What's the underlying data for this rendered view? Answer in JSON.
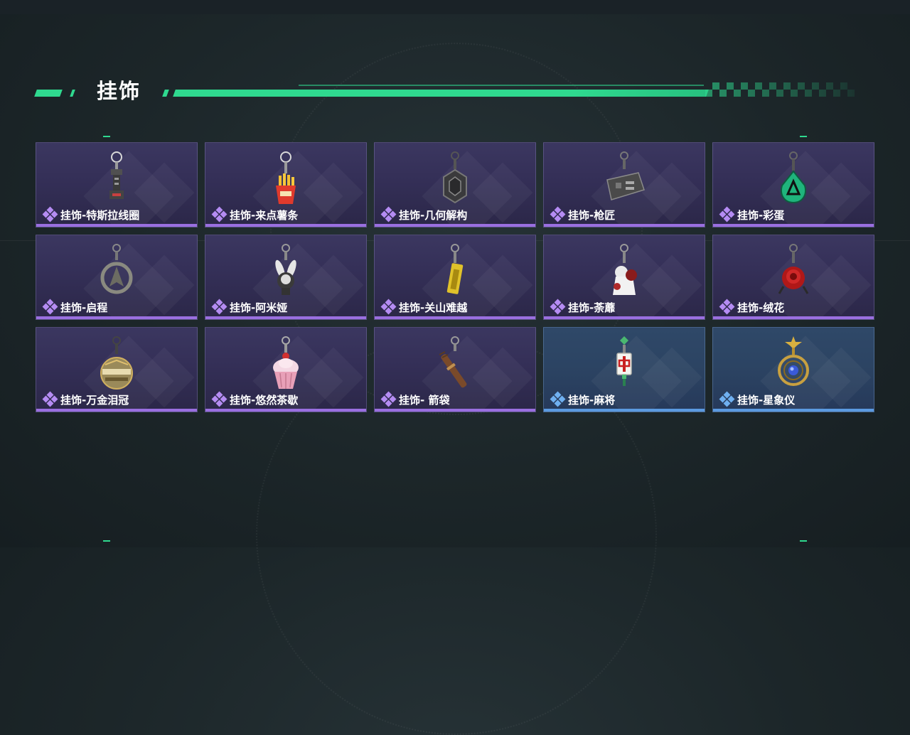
{
  "section": {
    "title": "挂饰"
  },
  "colors": {
    "accent": "#2fd98f",
    "rarity_purple": "#9a6fe0",
    "rarity_blue": "#5b9ae0"
  },
  "items": [
    {
      "name": "挂饰-特斯拉线圈",
      "rarity": "purple",
      "icon": "tesla-coil-charm-icon"
    },
    {
      "name": "挂饰-来点薯条",
      "rarity": "purple",
      "icon": "fries-charm-icon"
    },
    {
      "name": "挂饰-几何解构",
      "rarity": "purple",
      "icon": "geometric-charm-icon"
    },
    {
      "name": "挂饰-枪匠",
      "rarity": "purple",
      "icon": "gunsmith-charm-icon"
    },
    {
      "name": "挂饰-彩蛋",
      "rarity": "purple",
      "icon": "easter-egg-charm-icon"
    },
    {
      "name": "挂饰-启程",
      "rarity": "purple",
      "icon": "departure-charm-icon"
    },
    {
      "name": "挂饰-阿米娅",
      "rarity": "purple",
      "icon": "amiya-charm-icon"
    },
    {
      "name": "挂饰-关山难越",
      "rarity": "purple",
      "icon": "gold-bar-charm-icon"
    },
    {
      "name": "挂饰-荼蘼",
      "rarity": "purple",
      "icon": "flower-figure-charm-icon"
    },
    {
      "name": "挂饰-绒花",
      "rarity": "purple",
      "icon": "rose-charm-icon"
    },
    {
      "name": "挂饰-万金泪冠",
      "rarity": "purple",
      "icon": "crown-orb-charm-icon"
    },
    {
      "name": "挂饰-悠然茶歇",
      "rarity": "purple",
      "icon": "cupcake-charm-icon"
    },
    {
      "name": "挂饰- 箭袋",
      "rarity": "purple",
      "icon": "quiver-charm-icon"
    },
    {
      "name": "挂饰-麻将",
      "rarity": "blue",
      "icon": "mahjong-charm-icon"
    },
    {
      "name": "挂饰-星象仪",
      "rarity": "blue",
      "icon": "astrolabe-charm-icon"
    }
  ]
}
